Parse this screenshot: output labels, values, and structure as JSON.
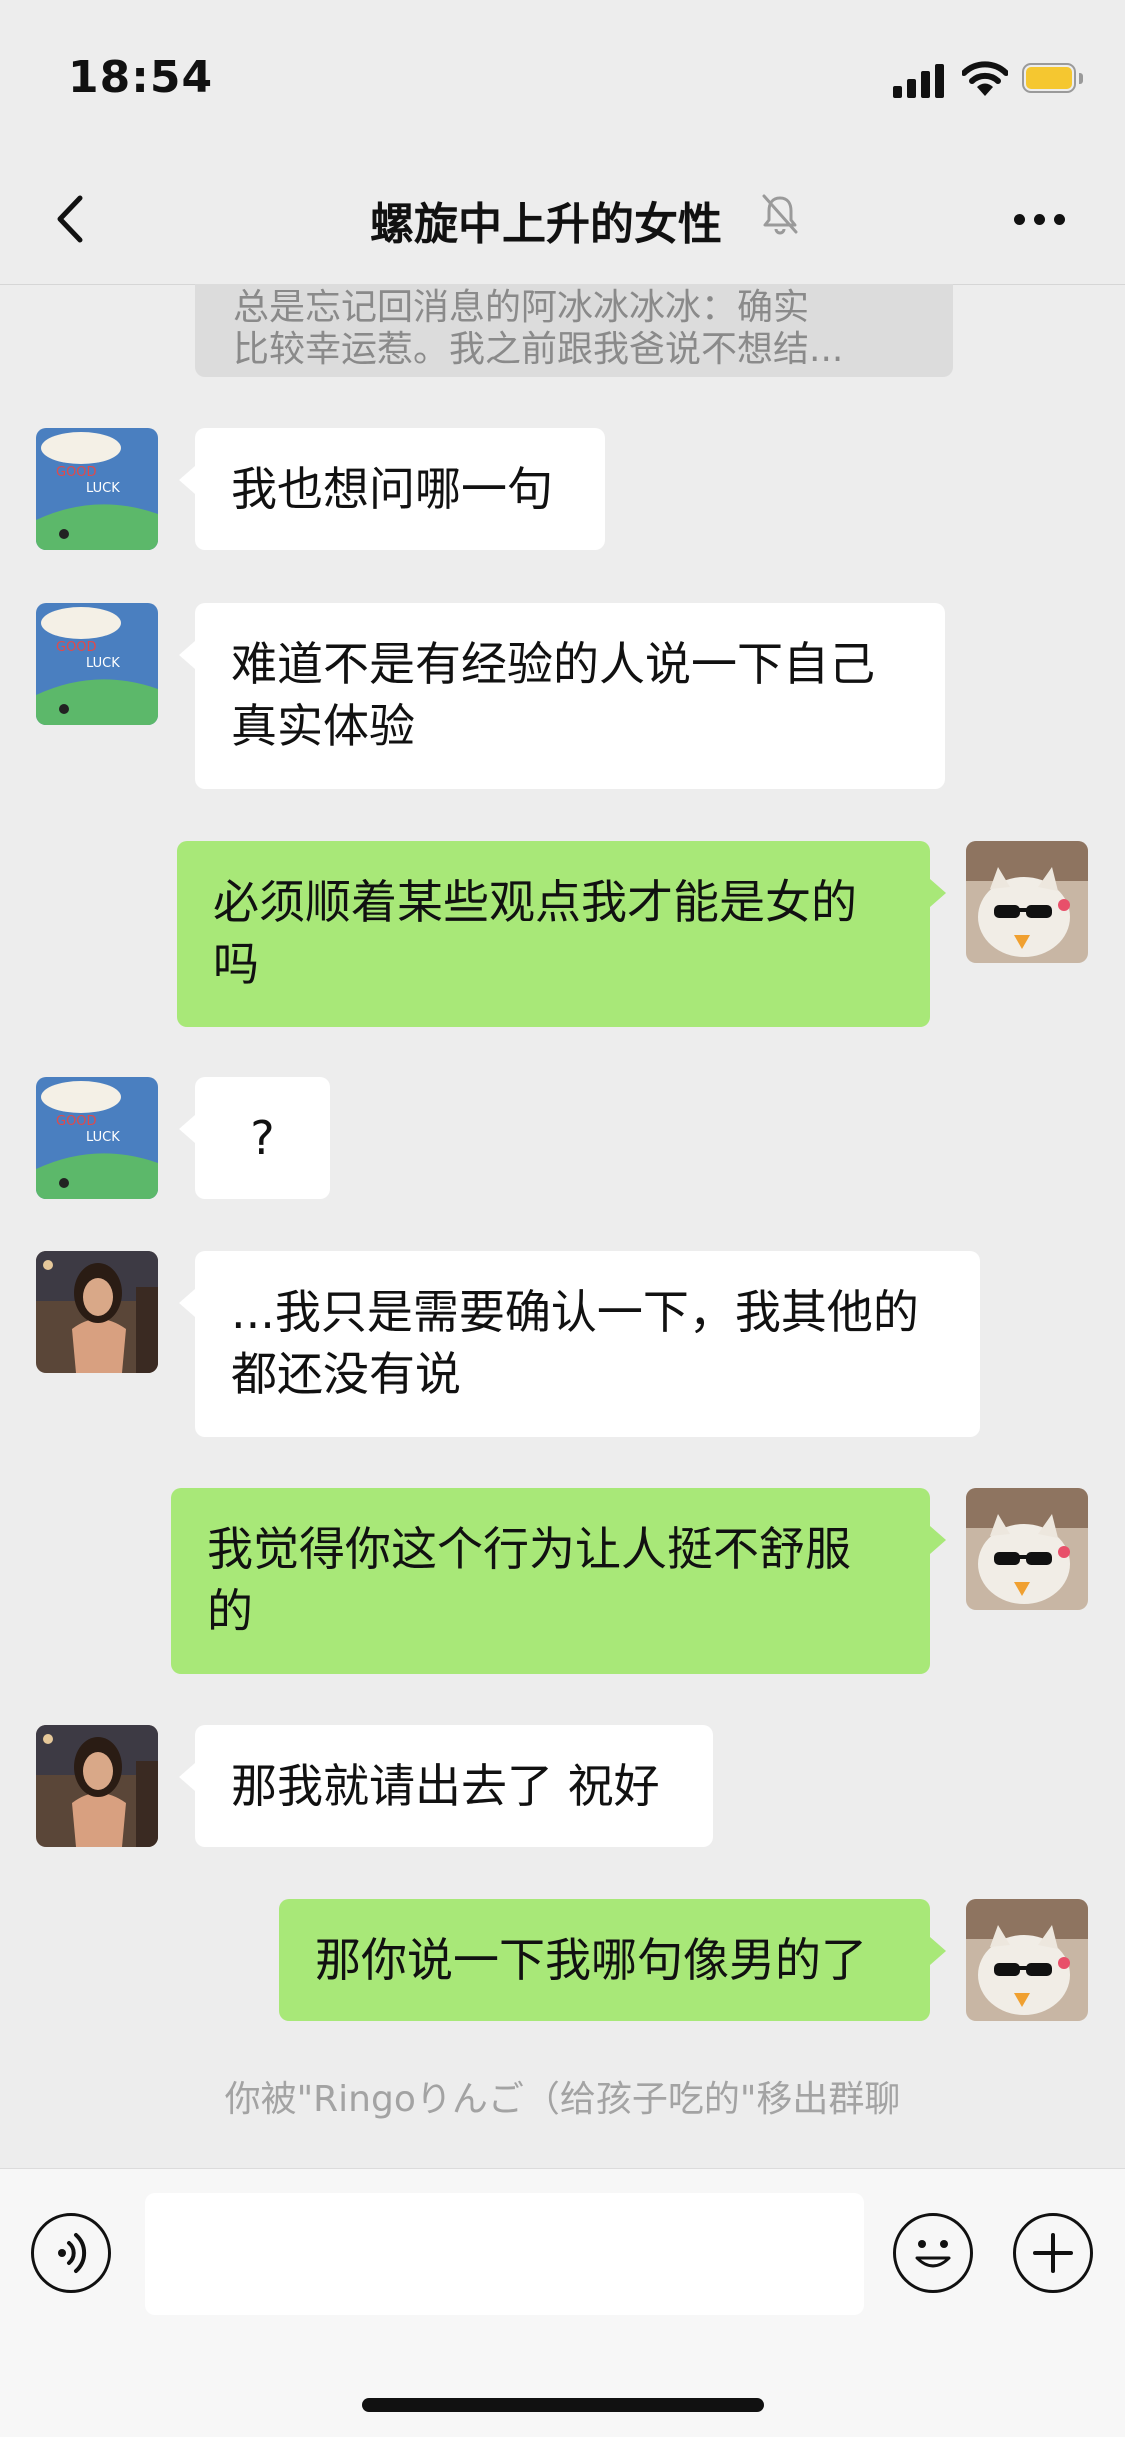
{
  "status_bar": {
    "time": "18:54"
  },
  "header": {
    "title": "螺旋中上升的女性"
  },
  "quoted_message": {
    "line1": "总是忘记回消息的阿冰冰冰冰：确实",
    "line2": "比较幸运惹。我之前跟我爸说不想结..."
  },
  "messages": [
    {
      "side": "in",
      "avatar": "good-luck-avatar",
      "text": "我也想问哪一句"
    },
    {
      "side": "in",
      "avatar": "good-luck-avatar",
      "text": "难道不是有经验的人说一下自己真实体验"
    },
    {
      "side": "out",
      "avatar": "cat-sunglasses-avatar",
      "text": "必须顺着某些观点我才能是女的吗"
    },
    {
      "side": "in",
      "avatar": "good-luck-avatar",
      "text": "?"
    },
    {
      "side": "in",
      "avatar": "woman-photo-avatar",
      "text": "...我只是需要确认一下，我其他的都还没有说"
    },
    {
      "side": "out",
      "avatar": "cat-sunglasses-avatar",
      "text": "我觉得你这个行为让人挺不舒服的"
    },
    {
      "side": "in",
      "avatar": "woman-photo-avatar",
      "text": "那我就请出去了 祝好"
    },
    {
      "side": "out",
      "avatar": "cat-sunglasses-avatar",
      "text": "那你说一下我哪句像男的了"
    }
  ],
  "system_notice": "你被\"Ringoりんご（给孩子吃的\"移出群聊",
  "avatar_text": {
    "good_luck_line1": "GOOD",
    "good_luck_line2": "LUCK"
  },
  "input": {
    "value": ""
  },
  "colors": {
    "incoming_bubble": "#ffffff",
    "outgoing_bubble": "#a8e878",
    "background": "#ededed"
  },
  "icons": [
    "signal-icon",
    "wifi-icon",
    "battery-icon",
    "back-arrow-icon",
    "mute-bell-icon",
    "more-icon",
    "voice-icon",
    "emoji-icon",
    "plus-icon"
  ]
}
